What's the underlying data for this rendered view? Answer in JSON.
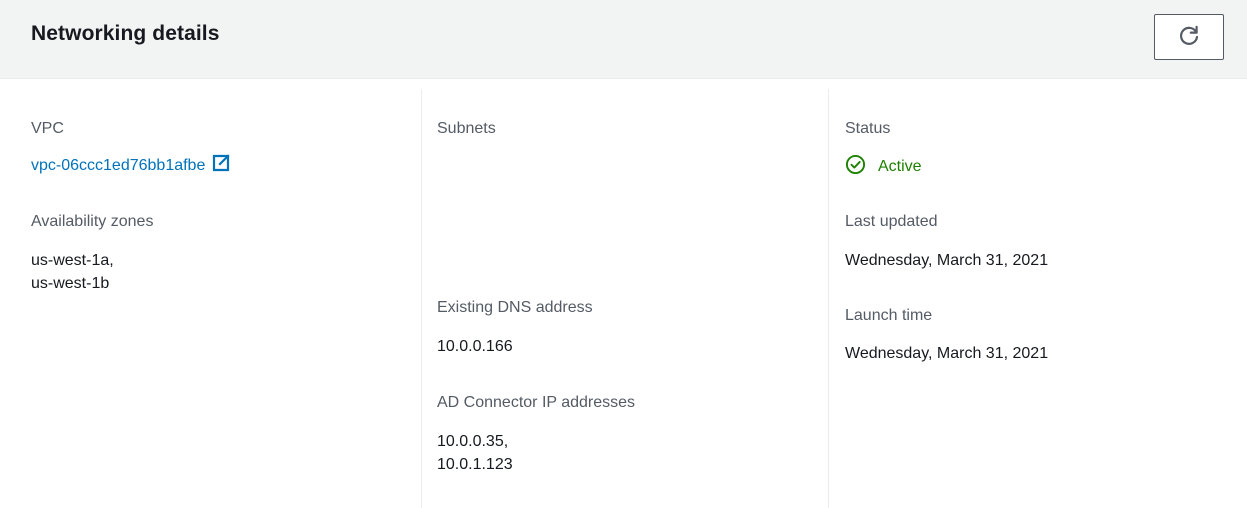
{
  "header": {
    "title": "Networking details",
    "refresh_icon": "refresh-icon"
  },
  "column1": {
    "vpc_label": "VPC",
    "vpc_link_text": "vpc-06ccc1ed76bb1afbe",
    "vpc_link_icon": "external-link-icon",
    "az_label": "Availability zones",
    "az_values": [
      "us-west-1a,",
      "us-west-1b"
    ]
  },
  "column2": {
    "subnets_label": "Subnets",
    "dns_label": "Existing DNS address",
    "dns_value": "10.0.0.166",
    "ad_ip_label": "AD Connector IP addresses",
    "ad_ip_values": [
      "10.0.0.35,",
      "10.0.1.123"
    ]
  },
  "column3": {
    "status_label": "Status",
    "status_value": "Active",
    "status_icon": "check-circle-icon",
    "last_updated_label": "Last updated",
    "last_updated_value": "Wednesday, March 31, 2021",
    "launch_time_label": "Launch time",
    "launch_time_value": "Wednesday, March 31, 2021"
  },
  "colors": {
    "link": "#0073bb",
    "success": "#1d8102",
    "header_bg": "#f2f3f3",
    "label": "#545b64",
    "text": "#16191f"
  }
}
